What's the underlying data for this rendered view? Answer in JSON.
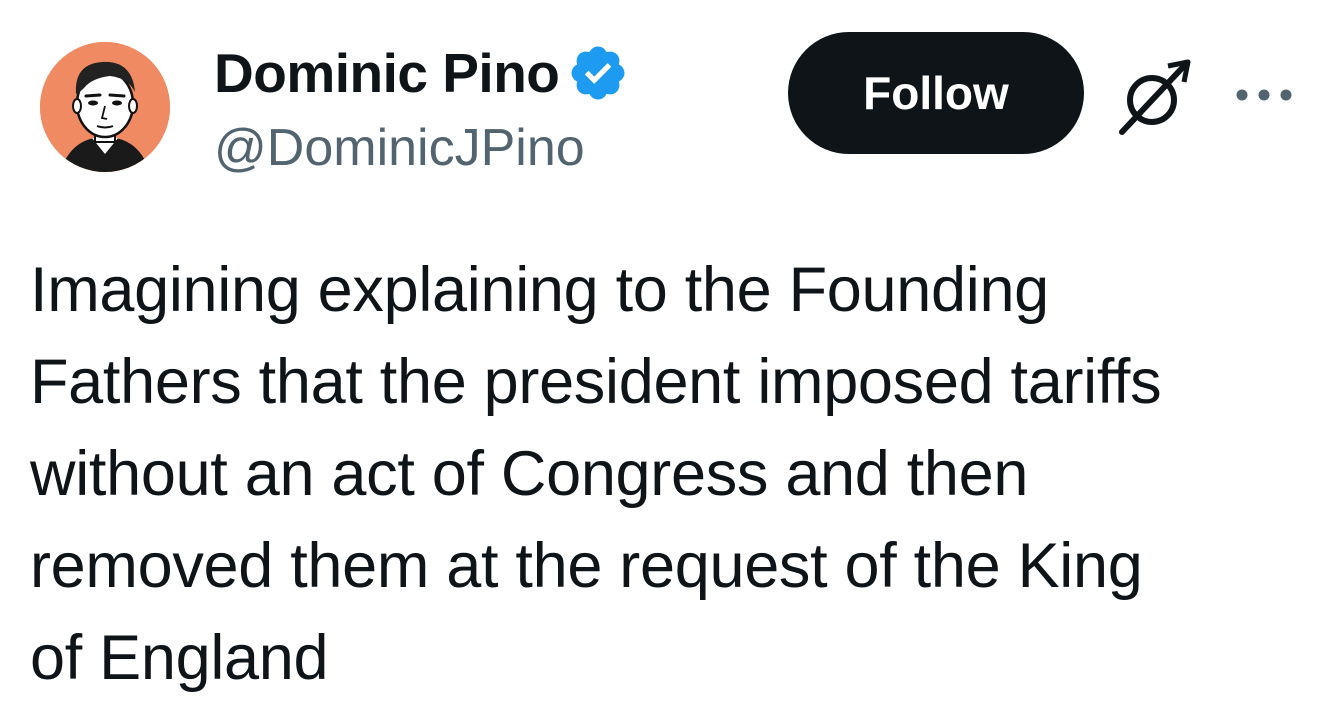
{
  "author": {
    "display_name": "Dominic Pino",
    "handle": "@DominicJPino",
    "verified": true
  },
  "actions": {
    "follow_label": "Follow",
    "grok_icon": "grok-icon",
    "more_icon": "more-icon"
  },
  "tweet": {
    "lines": [
      "Imagining explaining to the Founding",
      "Fathers that the president imposed tariffs",
      "without an act of Congress and then",
      "removed them at the request of the King",
      "of England"
    ]
  },
  "colors": {
    "text": "#0f1419",
    "secondary": "#536471",
    "follow_bg": "#0f1419",
    "verified": "#1d9bf0",
    "avatar_bg": "#f08a62"
  }
}
